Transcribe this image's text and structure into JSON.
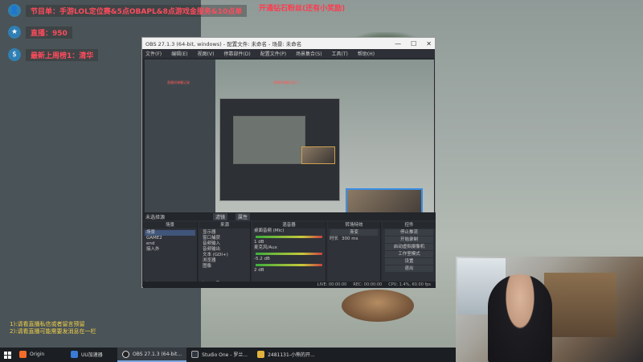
{
  "overlay": {
    "top_center": "开通钻石粉丝(还有小奖励)",
    "bars": [
      {
        "icon": "user-icon",
        "glyph": "👤",
        "text": "节目单：手游LOL定位赛&5点OBAPL&8点游戏金服务&10点单"
      },
      {
        "icon": "star-icon",
        "glyph": "★",
        "text": "直播：950"
      },
      {
        "icon": "coin-icon",
        "glyph": "$",
        "text": "最新上周榜1：清华"
      }
    ],
    "bottom_notes": [
      "1):请看直播私信或者留言预留",
      "2):请看直播可能需要发消息在一栏"
    ]
  },
  "obs": {
    "title": "OBS 27.1.3 (64-bit, windows) - 配置文件: 未命名 - 场景: 未命名",
    "window_controls": [
      "—",
      "☐",
      "✕"
    ],
    "menu": [
      "文件(F)",
      "编辑(E)",
      "视图(V)",
      "停靠部件(D)",
      "配置文件(P)",
      "场景集合(S)",
      "工具(T)",
      "帮助(H)"
    ],
    "preview_red_lines": [
      "直播间弹幕记录",
      "直播间弹幕记录 1",
      "直播间弹幕记录 2"
    ],
    "scene_bar": {
      "label": "未选择源",
      "filter_btn": "滤镜",
      "props_btn": "属性"
    },
    "docks": {
      "scenes": {
        "title": "场景",
        "items": [
          "场景",
          "GAME2",
          "end",
          "接入外"
        ],
        "selected": 0
      },
      "sources": {
        "title": "来源",
        "items": [
          "显示器",
          "窗口捕获",
          "音频输入",
          "音频输出",
          "文本 (GDI+)",
          "浏览器",
          "图像"
        ]
      },
      "mixer": {
        "title": "混音器",
        "items": [
          "桌面音频 (Mic)",
          "1 dB",
          "麦克风/Aux",
          "-5.2 dB",
          "2 dB"
        ]
      },
      "transitions": {
        "title": "转场特效",
        "type": "渐变",
        "duration_label": "时长",
        "duration": "300 ms"
      },
      "controls": {
        "title": "控件",
        "buttons": [
          "停止推流",
          "开始录制",
          "启动虚拟摄像机",
          "工作室模式",
          "设置",
          "退出"
        ]
      }
    },
    "status": [
      "LIVE: 00:00:00",
      "REC: 00:00:00",
      "CPU: 1.4%, 60.00 fps"
    ]
  },
  "taskbar": {
    "items": [
      {
        "label": "Origin",
        "icon": "origin-icon",
        "color": "#f46b2a",
        "active": false
      },
      {
        "label": "UU加速器",
        "icon": "uu-icon",
        "color": "#3a7bd5",
        "active": false
      },
      {
        "label": "OBS 27.1.3 (64-bit...",
        "icon": "obs-icon",
        "color": "#222222",
        "active": true
      },
      {
        "label": "Studio One - 罗兰...",
        "icon": "studio-one-icon",
        "color": "#2f3640",
        "active": false
      },
      {
        "label": "2481131-小熊的开...",
        "icon": "folder-icon",
        "color": "#e1b33c",
        "active": false
      }
    ]
  },
  "colors": {
    "accent_red": "#ff4b5c",
    "note_yellow": "#f2d14a",
    "obs_bg": "#26292e"
  }
}
